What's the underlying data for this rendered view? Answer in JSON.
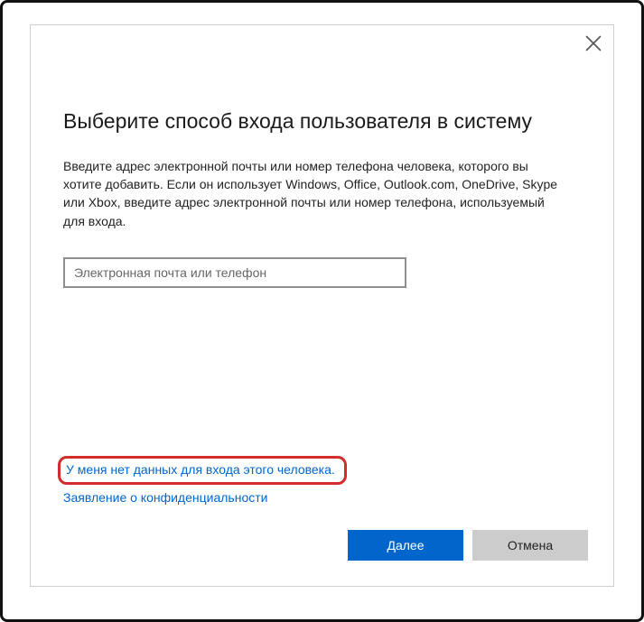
{
  "dialog": {
    "title": "Выберите способ входа пользователя в систему",
    "description": "Введите адрес электронной почты или номер телефона человека, которого вы хотите добавить. Если он использует Windows, Office, Outlook.com, OneDrive, Skype или Xbox, введите адрес электронной почты или номер телефона, используемый для входа.",
    "input": {
      "placeholder": "Электронная почта или телефон",
      "value": ""
    },
    "links": {
      "no_credentials": "У меня нет данных для входа этого человека.",
      "privacy": "Заявление о конфиденциальности"
    },
    "buttons": {
      "next": "Далее",
      "cancel": "Отмена"
    }
  }
}
